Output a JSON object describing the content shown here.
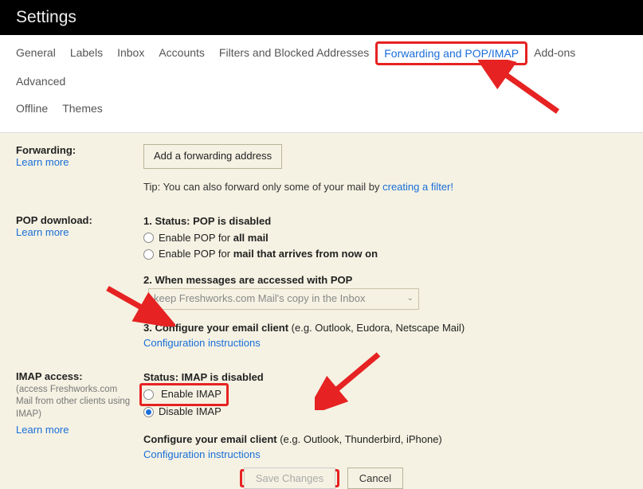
{
  "header": {
    "title": "Settings"
  },
  "tabs": {
    "general": "General",
    "labels": "Labels",
    "inbox": "Inbox",
    "accounts": "Accounts",
    "filters": "Filters and Blocked Addresses",
    "forwarding": "Forwarding and POP/IMAP",
    "addons": "Add-ons",
    "advanced": "Advanced",
    "offline": "Offline",
    "themes": "Themes"
  },
  "forwarding": {
    "label": "Forwarding:",
    "learn_more": "Learn more",
    "add_btn": "Add a forwarding address",
    "tip_prefix": "Tip: You can also forward only some of your mail by ",
    "tip_link": "creating a filter!"
  },
  "pop": {
    "label": "POP download:",
    "learn_more": "Learn more",
    "status_prefix": "1. Status: ",
    "status_value": "POP is disabled",
    "enable_all_prefix": "Enable POP for ",
    "enable_all_bold": "all mail",
    "enable_now_prefix": "Enable POP for ",
    "enable_now_bold": "mail that arrives from now on",
    "when_accessed": "2. When messages are accessed with POP",
    "select_value": "keep Freshworks.com Mail's copy in the Inbox",
    "configure_prefix": "3. Configure your email client ",
    "configure_hint": "(e.g. Outlook, Eudora, Netscape Mail)",
    "config_link": "Configuration instructions"
  },
  "imap": {
    "label": "IMAP access:",
    "sub": "(access Freshworks.com Mail from other clients using IMAP)",
    "learn_more": "Learn more",
    "status_prefix": "Status: ",
    "status_value": "IMAP is disabled",
    "enable": "Enable IMAP",
    "disable": "Disable IMAP",
    "configure_prefix": "Configure your email client ",
    "configure_hint": "(e.g. Outlook, Thunderbird, iPhone)",
    "config_link": "Configuration instructions"
  },
  "buttons": {
    "save": "Save Changes",
    "cancel": "Cancel"
  }
}
